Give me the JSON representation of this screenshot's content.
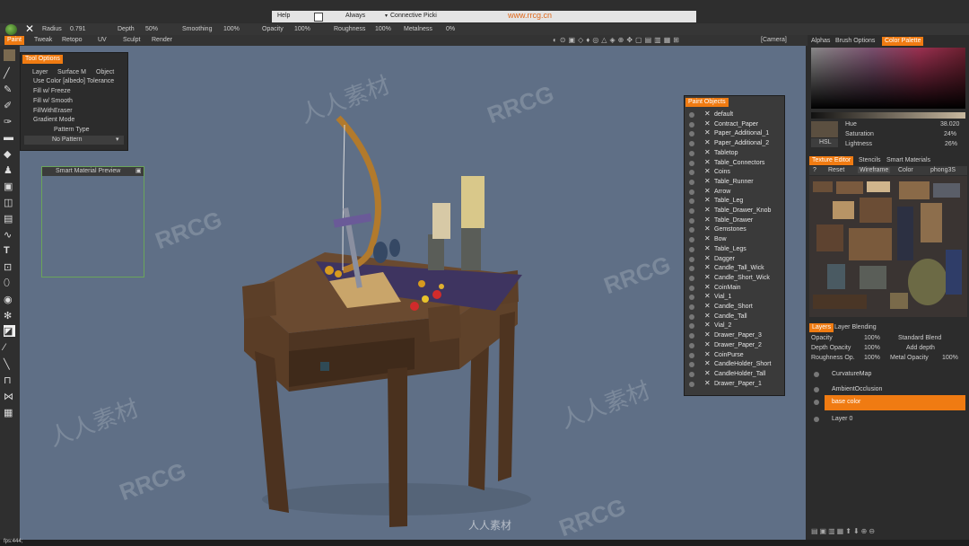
{
  "menu": {
    "help_label": "Help",
    "always_label": "Always",
    "connective_label": "Connective Picki"
  },
  "brush": {
    "radius_label": "Radius",
    "radius_value": "0.791",
    "depth_label": "Depth",
    "depth_value": "50%",
    "smoothing_label": "Smoothing",
    "smoothing_value": "100%",
    "opacity_label": "Opacity",
    "opacity_value": "100%",
    "roughness_label": "Roughness",
    "roughness_value": "100%",
    "metalness_label": "Metalness",
    "metalness_value": "0%"
  },
  "rooms": [
    "Paint",
    "Tweak",
    "Retopo",
    "UV",
    "Sculpt",
    "Render"
  ],
  "camera_label": "[Camera]",
  "tool_options": {
    "title": "Tool Options",
    "tabs": [
      "Layer",
      "Surface M",
      "Object"
    ],
    "options": [
      "Use Color [albedo] Tolerance",
      "Fill w/ Freeze",
      "Fill w/ Smooth",
      "FillWithEraser",
      "Gradient Mode"
    ],
    "pattern_type_label": "Pattern Type",
    "pattern_value": "No Pattern"
  },
  "smart_material_preview": {
    "title": "Smart Material Preview"
  },
  "paint_objects": {
    "title": "Paint Objects",
    "items": [
      "default",
      "Contract_Paper",
      "Paper_Additional_1",
      "Paper_Additional_2",
      "Tabletop",
      "Table_Connectors",
      "Coins",
      "Table_Runner",
      "Arrow",
      "Table_Leg",
      "Table_Drawer_Knob",
      "Table_Drawer",
      "Gemstones",
      "Bow",
      "Table_Legs",
      "Dagger",
      "Candle_Tall_Wick",
      "Candle_Short_Wick",
      "CoinMain",
      "Vial_1",
      "Candle_Short",
      "Candle_Tall",
      "Vial_2",
      "Drawer_Paper_3",
      "Drawer_Paper_2",
      "CoinPurse",
      "CandleHolder_Short",
      "CandleHolder_Tall",
      "Drawer_Paper_1"
    ]
  },
  "right_tabs": [
    "Alphas",
    "Brush Options",
    "Color Palette"
  ],
  "color": {
    "hsl_button": "HSL",
    "hue_label": "Hue",
    "hue_value": "38.020",
    "saturation_label": "Saturation",
    "saturation_value": "24%",
    "lightness_label": "Lightness",
    "lightness_value": "26%",
    "swatch": "#5b4f40"
  },
  "texture_tabs": [
    "Texture Editor",
    "Stencils",
    "Smart Materials"
  ],
  "texture_toolbar": {
    "help": "?",
    "reset": "Reset",
    "wireframe": "Wireframe",
    "color": "Color",
    "shader": "phong3S"
  },
  "layer_tabs": [
    "Layers",
    "Layer Blending"
  ],
  "layer_props": {
    "opacity_label": "Opacity",
    "opacity_value": "100%",
    "blend_value": "Standard Blend",
    "depth_opacity_label": "Depth Opacity",
    "depth_opacity_value": "100%",
    "depth_mode_value": "Add depth",
    "roughness_op_label": "Roughness Op.",
    "roughness_op_value": "100%",
    "metal_opacity_label": "Metal Opacity",
    "metal_opacity_value": "100%"
  },
  "layers": [
    "CurvatureMap",
    "AmbientOcclusion",
    "base color",
    "Layer 0"
  ],
  "active_layer_index": 2,
  "status": {
    "fps": "fps:444;"
  },
  "watermarks": [
    "人人素材",
    "RRCG",
    "www.rrcg.cn"
  ],
  "colors": {
    "accent": "#f07b12",
    "viewport": "#5f6f86"
  }
}
